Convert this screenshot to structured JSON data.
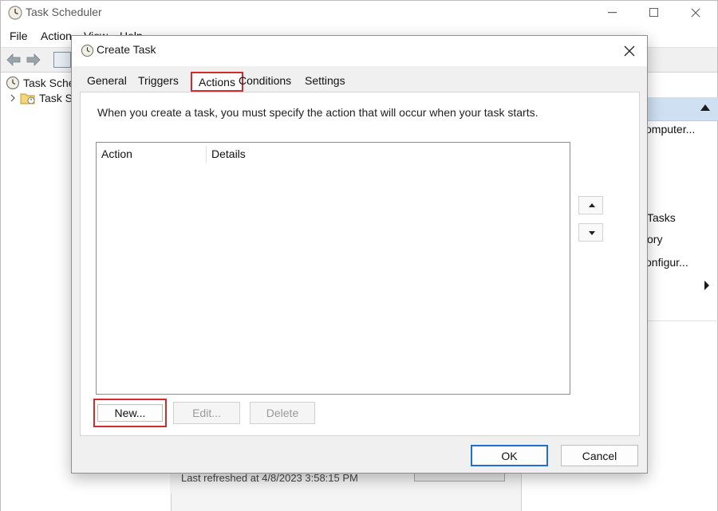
{
  "background_window": {
    "title": "Task Scheduler",
    "menu": [
      "File",
      "Action",
      "View",
      "Help"
    ],
    "tree": [
      {
        "label": "Task Sche",
        "icon": "clock-icon"
      },
      {
        "label": "Task S",
        "icon": "folder-clock-icon"
      }
    ],
    "status_text": "Last refreshed at 4/8/2023 3:58:15 PM",
    "actions_panel_items": [
      "omputer...",
      "Tasks",
      "ory",
      "onfigur..."
    ]
  },
  "dialog": {
    "title": "Create Task",
    "tabs": [
      "General",
      "Triggers",
      "Actions",
      "Conditions",
      "Settings"
    ],
    "active_tab": "Actions",
    "description": "When you create a task, you must specify the action that will occur when your task starts.",
    "list_columns": [
      "Action",
      "Details"
    ],
    "list_rows": [],
    "buttons": {
      "new": "New...",
      "edit": "Edit...",
      "delete": "Delete",
      "ok": "OK",
      "cancel": "Cancel"
    }
  },
  "colors": {
    "highlight": "#d22b2b",
    "accent": "#1e6fd0",
    "action_header": "#cfe0f3"
  }
}
